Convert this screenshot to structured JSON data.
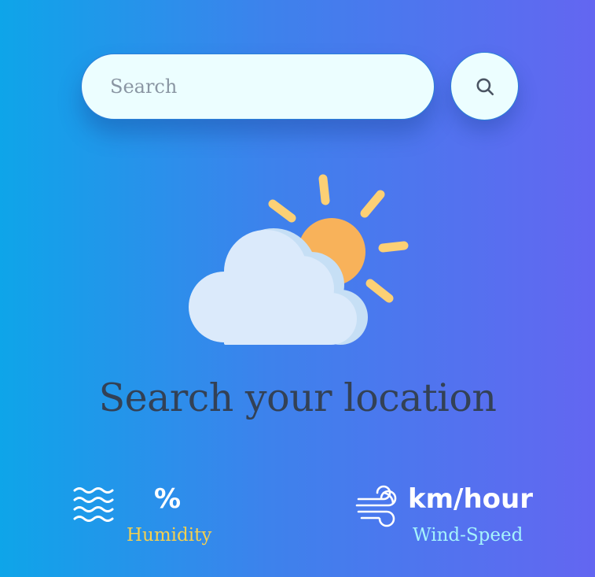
{
  "search": {
    "placeholder": "Search",
    "value": "",
    "button_icon": "search-icon"
  },
  "illustration": {
    "icon": "partly-cloudy-icon",
    "sun_color": "#f8b25a",
    "ray_color": "#fcd075",
    "cloud_color": "#dbeafb"
  },
  "headline": "Search your location",
  "humidity": {
    "icon": "waves-icon",
    "value": "%",
    "label": "Humidity",
    "label_color": "#f5d04e"
  },
  "wind": {
    "icon": "wind-icon",
    "value": "km/hour",
    "label": "Wind-Speed",
    "label_color": "#a5f3fc"
  }
}
